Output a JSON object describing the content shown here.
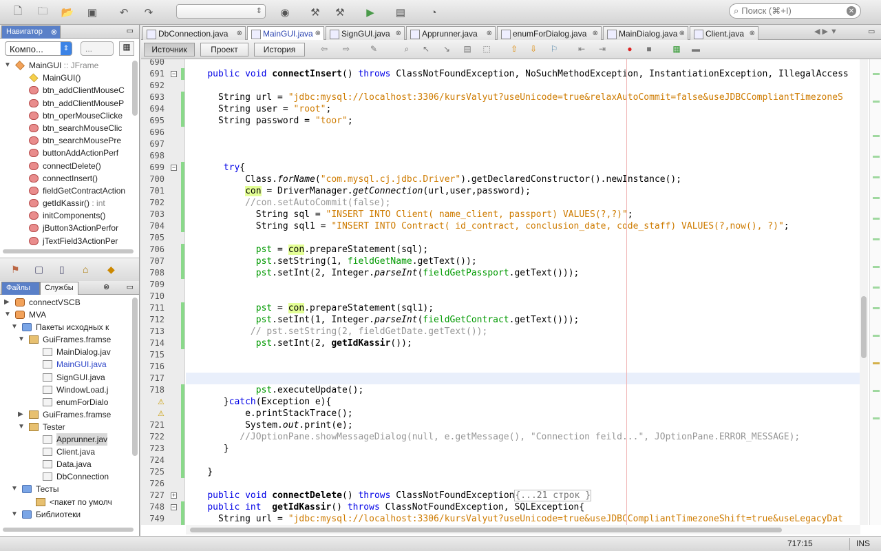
{
  "search": {
    "placeholder": "Поиск (⌘+I)"
  },
  "navigator": {
    "tab": "Навигатор",
    "filter": "Компо...",
    "filter2": "...",
    "items": [
      {
        "label": "MainGUI",
        "suffix": " :: JFrame",
        "icon": "class-icon",
        "exp": "▼",
        "indent": 0
      },
      {
        "label": "MainGUI()",
        "icon": "constructor-icon",
        "indent": 2
      },
      {
        "label": "btn_addClientMouseC",
        "icon": "method-icon",
        "indent": 2
      },
      {
        "label": "btn_addClientMouseP",
        "icon": "method-icon",
        "indent": 2
      },
      {
        "label": "btn_operMouseClicke",
        "icon": "method-icon",
        "indent": 2
      },
      {
        "label": "btn_searchMouseClic",
        "icon": "method-icon",
        "indent": 2
      },
      {
        "label": "btn_searchMousePre",
        "icon": "method-icon",
        "indent": 2
      },
      {
        "label": "buttonAddActionPerf",
        "icon": "method-icon",
        "indent": 2
      },
      {
        "label": "connectDelete()",
        "icon": "method-icon",
        "indent": 2
      },
      {
        "label": "connectInsert()",
        "icon": "method-icon",
        "indent": 2
      },
      {
        "label": "fieldGetContractAction",
        "icon": "method-icon",
        "indent": 2
      },
      {
        "label": "getIdKassir()",
        "suffix": " : int",
        "icon": "method-icon",
        "indent": 2
      },
      {
        "label": "initComponents()",
        "icon": "method-icon",
        "indent": 2
      },
      {
        "label": "jButton3ActionPerfor",
        "icon": "method-icon",
        "indent": 2
      },
      {
        "label": "jTextField3ActionPer",
        "icon": "method-icon",
        "indent": 2
      }
    ]
  },
  "projects": {
    "tabs": [
      "Файлы",
      "Службы"
    ],
    "items": [
      {
        "label": "connectVSCB",
        "exp": "▶",
        "indent": 0,
        "icon": "project-icon"
      },
      {
        "label": "MVA",
        "exp": "▼",
        "indent": 0,
        "icon": "project-icon"
      },
      {
        "label": "Пакеты исходных к",
        "exp": "▼",
        "indent": 1,
        "icon": "folder-icon"
      },
      {
        "label": "GuiFrames.framse",
        "exp": "▼",
        "indent": 2,
        "icon": "package-icon"
      },
      {
        "label": "MainDialog.jav",
        "indent": 4,
        "icon": "java-file-icon"
      },
      {
        "label": "MainGUI.java",
        "indent": 4,
        "icon": "java-file-icon",
        "active": true
      },
      {
        "label": "SignGUI.java",
        "indent": 4,
        "icon": "java-file-icon"
      },
      {
        "label": "WindowLoad.j",
        "indent": 4,
        "icon": "java-file-icon"
      },
      {
        "label": "enumForDialo",
        "indent": 4,
        "icon": "java-file-icon"
      },
      {
        "label": "GuiFrames.framse",
        "exp": "▶",
        "indent": 2,
        "icon": "package-icon"
      },
      {
        "label": "Tester",
        "exp": "▼",
        "indent": 2,
        "icon": "package-icon"
      },
      {
        "label": "Apprunner.jav",
        "indent": 4,
        "icon": "java-file-icon",
        "selected": true
      },
      {
        "label": "Client.java",
        "indent": 4,
        "icon": "java-file-icon"
      },
      {
        "label": "Data.java",
        "indent": 4,
        "icon": "java-file-icon"
      },
      {
        "label": "DbConnection",
        "indent": 4,
        "icon": "java-file-icon"
      },
      {
        "label": "Тесты",
        "exp": "▼",
        "indent": 1,
        "icon": "folder-icon"
      },
      {
        "label": "<пакет по умолч",
        "indent": 3,
        "icon": "package-icon"
      },
      {
        "label": "Библиотеки",
        "exp": "▼",
        "indent": 1,
        "icon": "folder-icon"
      }
    ]
  },
  "editor_tabs": [
    {
      "label": "DbConnection.java",
      "w": 150
    },
    {
      "label": "MainGUI.java",
      "w": 112,
      "active": true
    },
    {
      "label": "SignGUI.java",
      "w": 115
    },
    {
      "label": "Apprunner.java",
      "w": 130
    },
    {
      "label": "enumForDialog.java",
      "w": 152
    },
    {
      "label": "MainDialog.java",
      "w": 124
    },
    {
      "label": "Client.java",
      "w": 100
    }
  ],
  "source_tabs": [
    "Источник",
    "Проект",
    "История"
  ],
  "lines": [
    {
      "n": "690"
    },
    {
      "n": "691",
      "fold": "−"
    },
    {
      "n": "692"
    },
    {
      "n": "693"
    },
    {
      "n": "694"
    },
    {
      "n": "695"
    },
    {
      "n": "696"
    },
    {
      "n": "697"
    },
    {
      "n": "698"
    },
    {
      "n": "699",
      "fold": "−"
    },
    {
      "n": "700"
    },
    {
      "n": "701"
    },
    {
      "n": "702"
    },
    {
      "n": "703"
    },
    {
      "n": "704"
    },
    {
      "n": "705"
    },
    {
      "n": "706"
    },
    {
      "n": "707"
    },
    {
      "n": "708"
    },
    {
      "n": "709"
    },
    {
      "n": "710"
    },
    {
      "n": "711"
    },
    {
      "n": "712"
    },
    {
      "n": "713"
    },
    {
      "n": "714"
    },
    {
      "n": "715"
    },
    {
      "n": "716"
    },
    {
      "n": "717"
    },
    {
      "n": "718"
    },
    {
      "n": "",
      "warn": true
    },
    {
      "n": "",
      "warn": true
    },
    {
      "n": "721"
    },
    {
      "n": "722"
    },
    {
      "n": "723"
    },
    {
      "n": "724"
    },
    {
      "n": "725"
    },
    {
      "n": "726"
    },
    {
      "n": "727",
      "fold": "+"
    },
    {
      "n": "748",
      "fold": "−"
    },
    {
      "n": "749"
    }
  ],
  "code": [
    "",
    "    public void connectInsert() throws ClassNotFoundException, NoSuchMethodException, InstantiationException, IllegalAccess",
    "",
    "      String url = \"jdbc:mysql://localhost:3306/kursValyut?useUnicode=true&relaxAutoCommit=false&useJDBCCompliantTimezoneS",
    "      String user = \"root\";",
    "      String password = \"toor\";",
    "",
    "",
    "",
    "       try{",
    "           Class.forName(\"com.mysql.cj.jdbc.Driver\").getDeclaredConstructor().newInstance();",
    "           con = DriverManager.getConnection(url,user,password);",
    "           //con.setAutoCommit(false);",
    "             String sql = \"INSERT INTO Client( name_client, passport) VALUES(?,?)\";",
    "             String sql1 = \"INSERT INTO Contract( id_contract, conclusion_date, code_staff) VALUES(?,now(), ?)\";",
    "",
    "             pst = con.prepareStatement(sql);",
    "             pst.setString(1, fieldGetName.getText());",
    "             pst.setInt(2, Integer.parseInt(fieldGetPassport.getText()));",
    "",
    "",
    "             pst = con.prepareStatement(sql1);",
    "             pst.setInt(1, Integer.parseInt(fieldGetContract.getText()));",
    "            // pst.setString(2, fieldGetDate.getText());",
    "             pst.setInt(2, getIdKassir());",
    "",
    "",
    "",
    "             pst.executeUpdate();",
    "       }catch(Exception e){",
    "           e.printStackTrace();",
    "           System.out.print(e);",
    "          //JOptionPane.showMessageDialog(null, e.getMessage(), \"Connection feild...\", JOptionPane.ERROR_MESSAGE);",
    "       }",
    "",
    "    }",
    "",
    "    public void connectDelete() throws ClassNotFoundException{...21 строк }",
    "    public int  getIdKassir() throws ClassNotFoundException, SQLException{",
    "      String url = \"jdbc:mysql://localhost:3306/kursValyut?useUnicode=true&useJDBCCompliantTimezoneShift=true&useLegacyDat"
  ],
  "status": {
    "position": "717:15",
    "mode": "INS"
  },
  "colors": {
    "keyword": "#0000e6",
    "string": "#ce7b00",
    "comment": "#969696",
    "changed": "#8ad98a",
    "current_line": "#e9effb"
  }
}
